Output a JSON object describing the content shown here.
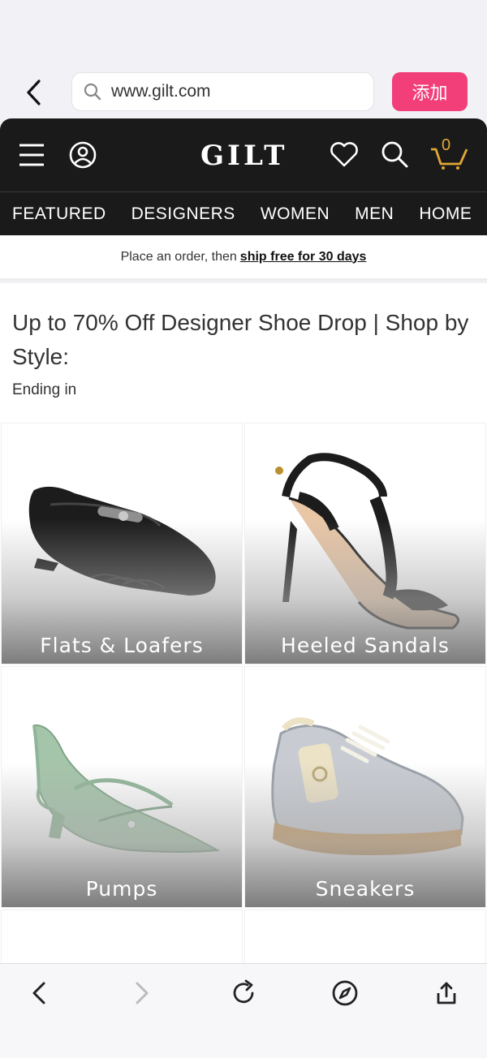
{
  "browser": {
    "url": "www.gilt.com",
    "add_button_label": "添加"
  },
  "header": {
    "logo": "GILT",
    "cart_count": "0",
    "accent_color": "#e0a736"
  },
  "nav": {
    "items": [
      "FEATURED",
      "DESIGNERS",
      "WOMEN",
      "MEN",
      "HOME"
    ]
  },
  "promo": {
    "text": "Place an order, then",
    "link": "ship free for 30 days"
  },
  "main": {
    "title": "Up to 70% Off Designer Shoe Drop | Shop by Style:",
    "ending": "Ending in",
    "categories": [
      {
        "label": "Flats & Loafers",
        "icon": "loafer-image"
      },
      {
        "label": "Heeled Sandals",
        "icon": "sandal-image"
      },
      {
        "label": "Pumps",
        "icon": "pump-image"
      },
      {
        "label": "Sneakers",
        "icon": "sneaker-image"
      }
    ]
  },
  "toolbar": {
    "icons": [
      "back-icon",
      "forward-icon",
      "reload-icon",
      "compass-icon",
      "share-icon"
    ]
  },
  "colors": {
    "header_bg": "#1a1a1a",
    "add_button": "#f23f7a"
  }
}
